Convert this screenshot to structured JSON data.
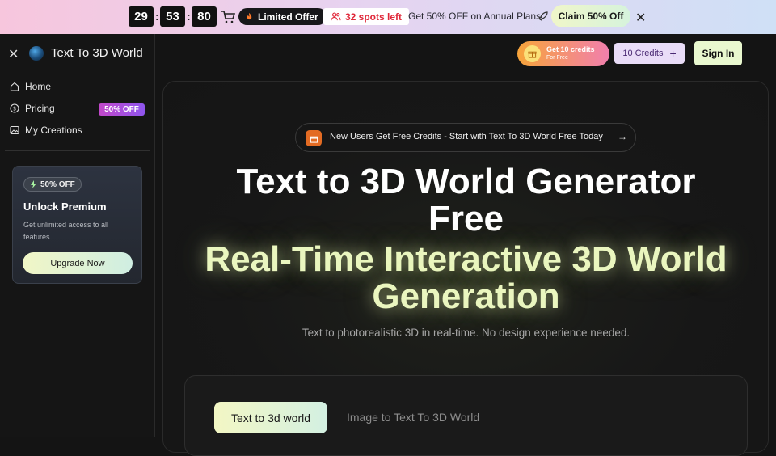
{
  "promo": {
    "timer": [
      "29",
      "53",
      "80"
    ],
    "limited_offer": "Limited Offer",
    "spots_left": "32 spots left",
    "annual_text": "Get 50% OFF on Annual Plans",
    "claim_label": "Claim 50% Off"
  },
  "sidebar": {
    "brand": "Text To 3D World",
    "nav": [
      {
        "label": "Home",
        "icon": "home-icon"
      },
      {
        "label": "Pricing",
        "icon": "dollar-icon",
        "badge": "50% OFF"
      },
      {
        "label": "My Creations",
        "icon": "image-icon"
      }
    ],
    "premium": {
      "badge": "50% OFF",
      "title": "Unlock Premium",
      "description": "Get unlimited access to all features",
      "button": "Upgrade Now"
    }
  },
  "header": {
    "credits_promo_title": "Get 10 credits",
    "credits_promo_sub": "For Free",
    "credits_label": "10 Credits",
    "signin_label": "Sign In"
  },
  "main": {
    "announcement": "New Users Get Free Credits - Start with Text To 3D World Free Today",
    "title_line1": "Text to 3D World Generator",
    "title_line2": "Free",
    "highlight_line1": "Real-Time Interactive 3D World",
    "highlight_line2": "Generation",
    "subtitle": "Text to photorealistic 3D in real-time. No design experience needed.",
    "tabs": [
      {
        "label": "Text to 3d world",
        "active": true
      },
      {
        "label": "Image to Text To 3D World",
        "active": false
      }
    ]
  },
  "colors": {
    "accent_lime": "#eaf6bf",
    "badge_purple": "#a34fdc",
    "alert_red": "#e0283a",
    "orange": "#e36b23"
  }
}
